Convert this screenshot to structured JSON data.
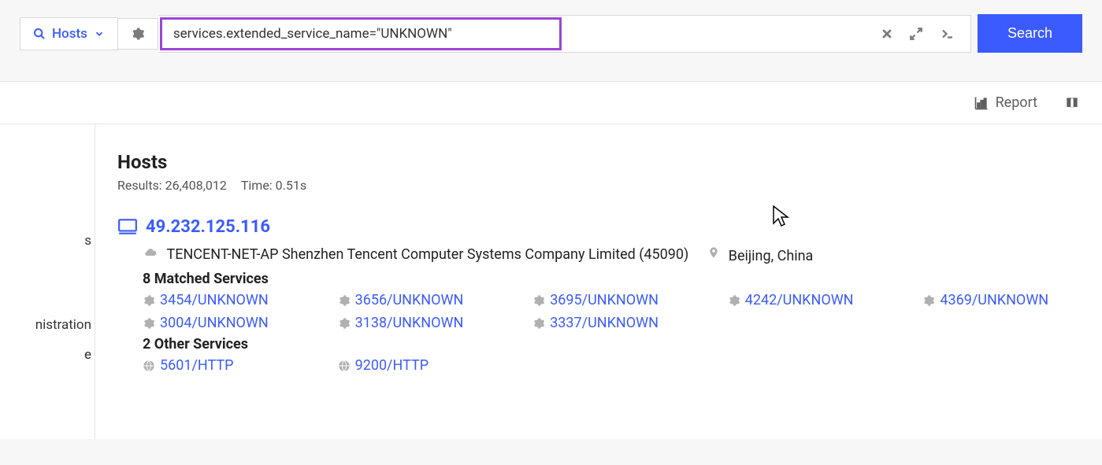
{
  "topbar": {
    "hosts_label": "Hosts",
    "search_value": "services.extended_service_name=\"UNKNOWN\"",
    "search_button": "Search"
  },
  "subbar": {
    "report_label": "Report"
  },
  "sidebar_fragments": [
    "s",
    "nistration",
    "e"
  ],
  "results": {
    "heading": "Hosts",
    "count_label": "Results: 26,408,012",
    "time_label": "Time: 0.51s"
  },
  "host": {
    "ip": "49.232.125.116",
    "asn": "TENCENT-NET-AP Shenzhen Tencent Computer Systems Company Limited (45090)",
    "location": "Beijing, China",
    "matched_label": "8 Matched Services",
    "matched": [
      "3454/UNKNOWN",
      "3656/UNKNOWN",
      "3695/UNKNOWN",
      "4242/UNKNOWN",
      "4369/UNKNOWN",
      "3004/UNKNOWN",
      "3138/UNKNOWN",
      "3337/UNKNOWN"
    ],
    "other_label": "2 Other Services",
    "other": [
      "5601/HTTP",
      "9200/HTTP"
    ]
  }
}
